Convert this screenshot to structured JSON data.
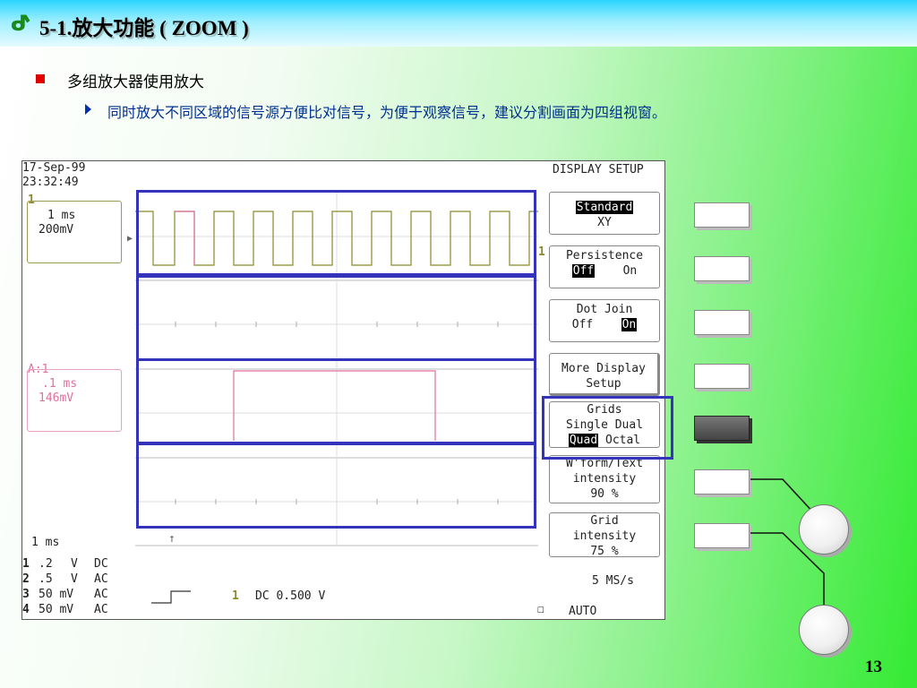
{
  "slide": {
    "title": "5-1.放大功能 ( ZOOM )",
    "title_icon": "ribbon-logo-icon",
    "bullet1": "多组放大器使用放大",
    "bullet2": "同时放大不同区域的信号源方便比对信号，为便于观察信号，建议分割画面为四组视窗。",
    "page_number": "13"
  },
  "scope": {
    "date": "17-Sep-99",
    "time": "23:32:49",
    "menu_title": "DISPLAY SETUP",
    "trace1": {
      "marker": "1",
      "timebase": "1 ms",
      "volts": "200mV"
    },
    "trace_a": {
      "marker": "A:1",
      "timebase": ".1 ms",
      "volts": "146mV"
    },
    "trace1_right_marker": "1",
    "timebase": "1 ms",
    "channels": [
      {
        "num": "1",
        "scale": ".2",
        "unit": "V",
        "coupling": "DC"
      },
      {
        "num": "2",
        "scale": ".5",
        "unit": "V",
        "coupling": "AC"
      },
      {
        "num": "3",
        "scale": "50 mV",
        "unit": "",
        "coupling": "AC"
      },
      {
        "num": "4",
        "scale": "50 mV",
        "unit": "",
        "coupling": "AC"
      }
    ],
    "trigger_source": "1",
    "trigger_level": "DC 0.500 V",
    "sample_rate": "5 MS/s",
    "trigger_mode": "AUTO",
    "menu": {
      "display_standard": "Standard",
      "display_xy": "XY",
      "persistence_label": "Persistence",
      "persistence_off": "Off",
      "persistence_on": "On",
      "dotjoin_label": "Dot Join",
      "dotjoin_off": "Off",
      "dotjoin_on": "On",
      "more_line1": "More Display",
      "more_line2": "Setup",
      "grids_label": "Grids",
      "grids_single": "Single",
      "grids_dual": "Dual",
      "grids_quad": "Quad",
      "grids_octal": "Octal",
      "wform_label": "W'form/Text",
      "wform_line": "intensity",
      "wform_value": "90 %",
      "grid_label": "Grid",
      "grid_line": "intensity",
      "grid_value": "75 %"
    }
  },
  "colors": {
    "trace1": "#8a8a2a",
    "trace_a": "#e070a0",
    "highlight": "#3333bb",
    "bullet_square": "#e00000"
  }
}
